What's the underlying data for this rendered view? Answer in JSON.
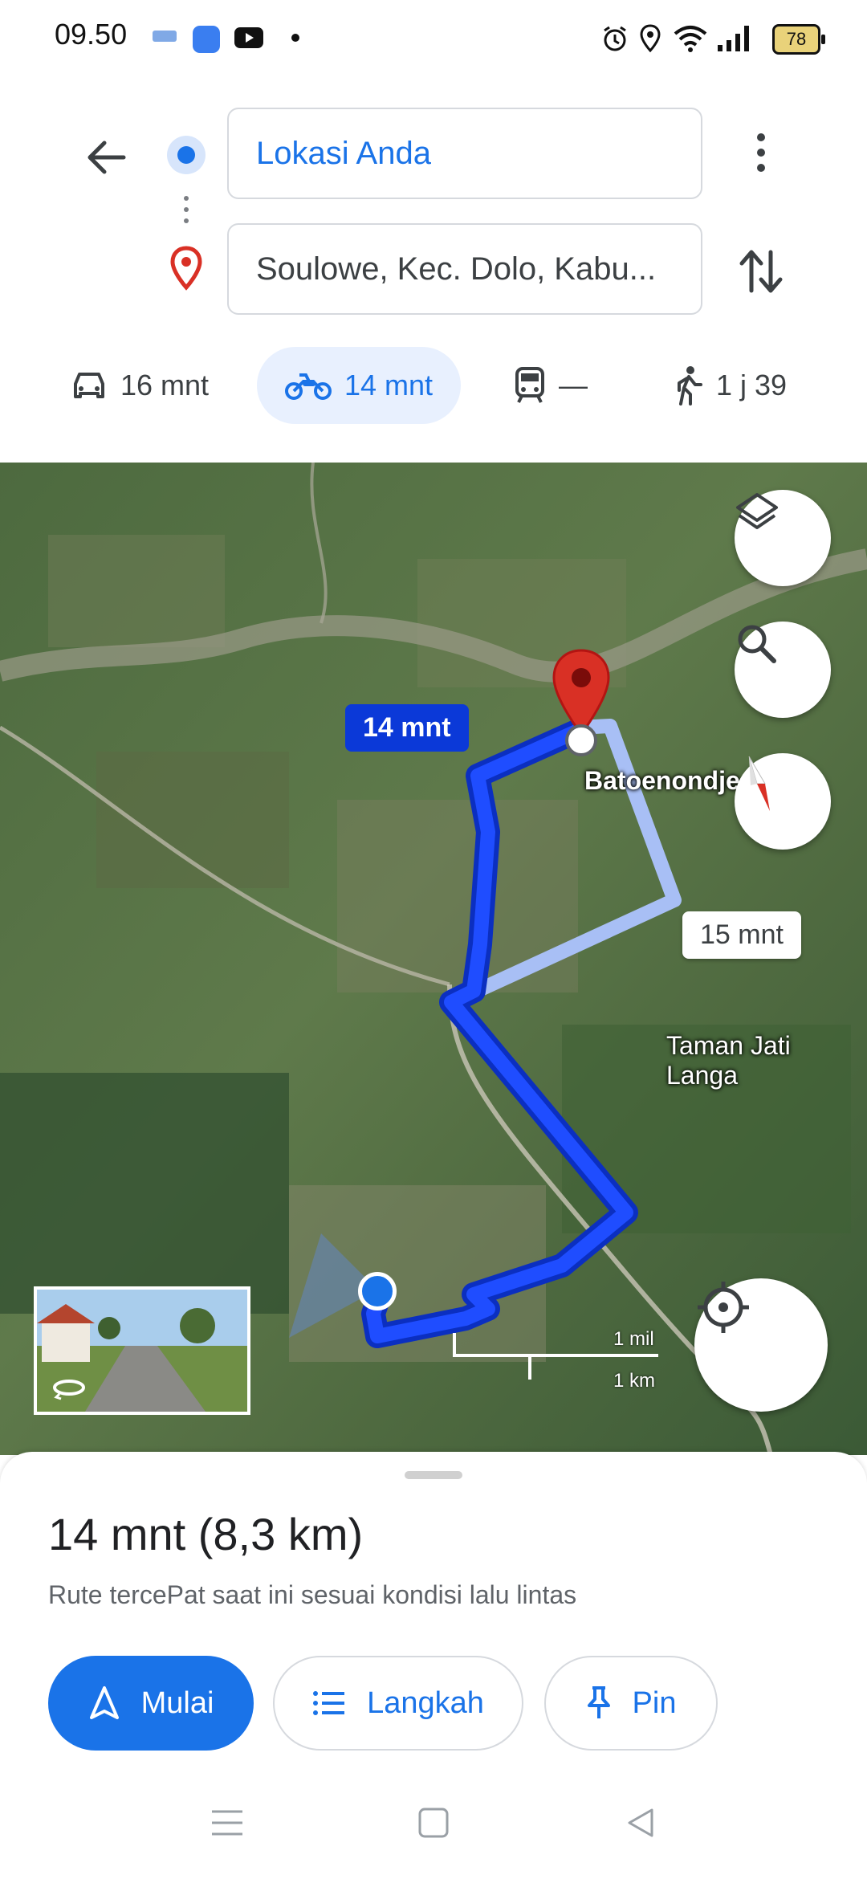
{
  "status_bar": {
    "time": "09.50",
    "battery": "78",
    "icons": [
      "alarm-icon",
      "location-icon",
      "wifi-icon",
      "signal-icon"
    ]
  },
  "search": {
    "origin": "Lokasi Anda",
    "destination": "Soulowe, Kec. Dolo, Kabu..."
  },
  "modes": [
    {
      "icon": "car-icon",
      "label": "16 mnt"
    },
    {
      "icon": "motorcycle-icon",
      "label": "14 mnt",
      "selected": true
    },
    {
      "icon": "transit-icon",
      "label": "—"
    },
    {
      "icon": "walk-icon",
      "label": "1 j 39"
    }
  ],
  "map": {
    "main_route_label": "14 mnt",
    "alt_route_label": "15 mnt",
    "place_labels": [
      "Batoenondje",
      "Taman Jati Langa"
    ],
    "scale": {
      "mile": "1 mil",
      "km": "1 km"
    }
  },
  "sheet": {
    "title": "14 mnt (8,3 km)",
    "subtitle": "Rute tercePat saat ini sesuai kondisi lalu lintas",
    "buttons": {
      "start": "Mulai",
      "steps": "Langkah",
      "pin": "Pin"
    }
  },
  "colors": {
    "accent": "#1a73e8",
    "route": "#0b39d8",
    "alt_route": "#a8bff5",
    "pin": "#d93025"
  }
}
